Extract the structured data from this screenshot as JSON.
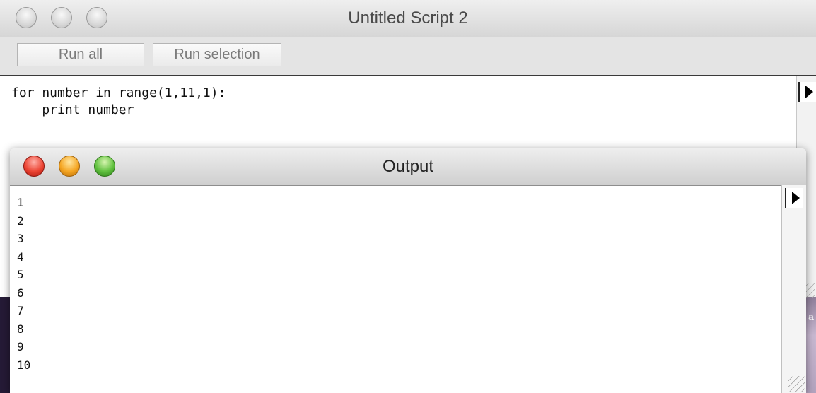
{
  "script_window": {
    "title": "Untitled Script 2",
    "buttons": {
      "run_all": "Run all",
      "run_selection": "Run selection"
    },
    "code_lines": [
      "for number in range(1,11,1):",
      "    print number"
    ]
  },
  "output_window": {
    "title": "Output",
    "lines": [
      "1",
      "2",
      "3",
      "4",
      "5",
      "6",
      "7",
      "8",
      "9",
      "10"
    ]
  },
  "background_app_label": "a",
  "icons": {
    "traffic_lights_inactive": [
      "close-icon",
      "minimize-icon",
      "zoom-icon"
    ],
    "traffic_lights_active": [
      "close-icon",
      "minimize-icon",
      "zoom-icon"
    ],
    "scroll_disclosure": "disclosure-triangle-icon",
    "resize": "resize-grip-icon"
  },
  "colors": {
    "close": "#ec4433",
    "minimize": "#f5a623",
    "zoom": "#61c13f"
  }
}
